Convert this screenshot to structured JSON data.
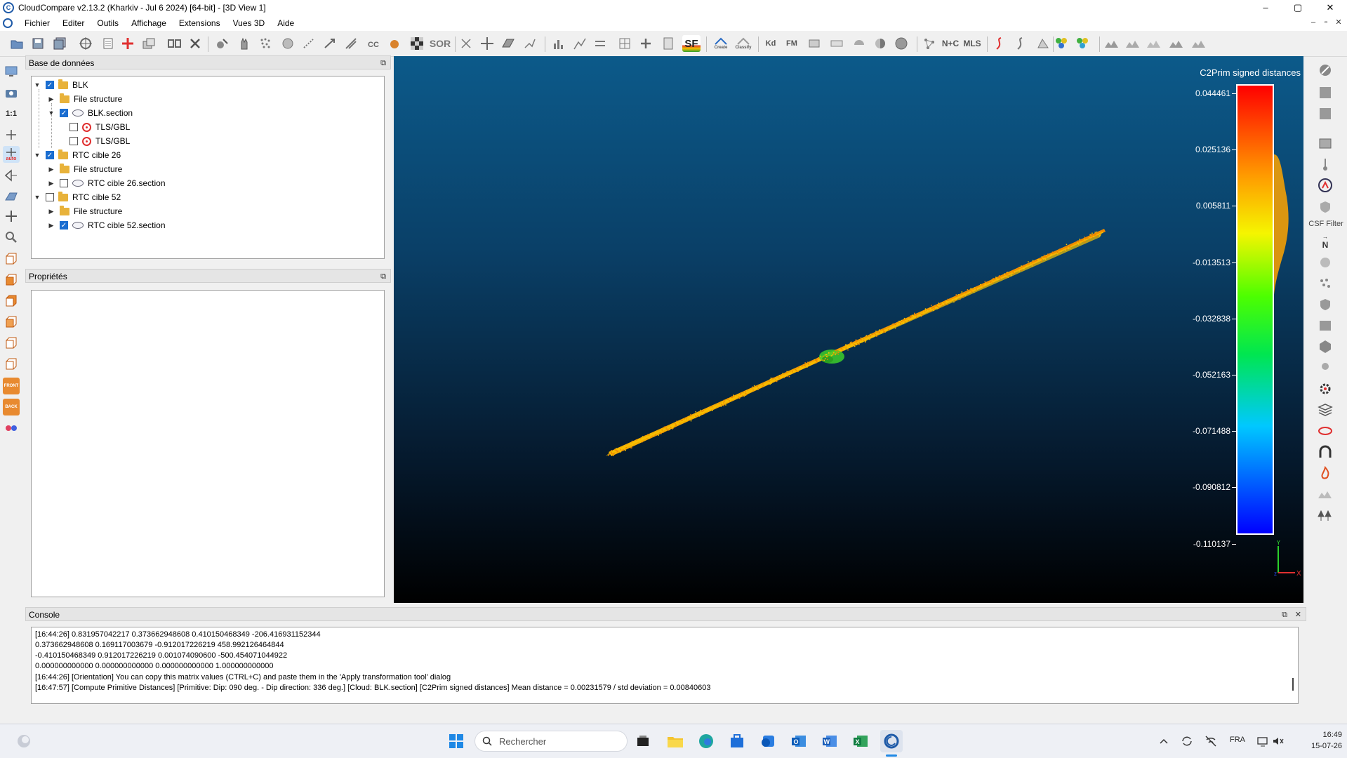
{
  "window": {
    "title": "CloudCompare v2.13.2 (Kharkiv - Jul  6 2024) [64-bit] - [3D View 1]",
    "minimize": "–",
    "maximize": "▢",
    "close": "✕"
  },
  "menu": {
    "items": [
      "Fichier",
      "Editer",
      "Outils",
      "Affichage",
      "Extensions",
      "Vues 3D",
      "Aide"
    ]
  },
  "toolbar": {
    "sor_label": "SOR",
    "sf_label": "SF",
    "kd_label": "Kd",
    "fm_label": "FM",
    "nc_label": "N+C",
    "mls_label": "MLS",
    "cloth_create": "Create",
    "cloth_classify": "Classify"
  },
  "left_toolbar": {
    "scale_label": "1:1",
    "auto_label": "auto",
    "front_label": "FRONT",
    "back_label": "BACK"
  },
  "db_panel": {
    "title": "Base de données",
    "tree": [
      {
        "label": "BLK",
        "checked": true,
        "expanded": true,
        "icon": "folder-icon"
      },
      {
        "label": "File structure",
        "icon": "folder-icon"
      },
      {
        "label": "BLK.section",
        "checked": true,
        "expanded": true,
        "icon": "cloud-icon"
      },
      {
        "label": "TLS/GBL",
        "checked": false,
        "icon": "target-icon"
      },
      {
        "label": "TLS/GBL",
        "checked": false,
        "icon": "target-icon"
      },
      {
        "label": "RTC cible 26",
        "checked": true,
        "expanded": true,
        "icon": "folder-icon"
      },
      {
        "label": "File structure",
        "icon": "folder-icon"
      },
      {
        "label": "RTC cible 26.section",
        "checked": false,
        "icon": "cloud-icon"
      },
      {
        "label": "RTC cible 52",
        "checked": false,
        "expanded": true,
        "icon": "folder-icon"
      },
      {
        "label": "File structure",
        "icon": "folder-icon"
      },
      {
        "label": "RTC cible 52.section",
        "checked": true,
        "icon": "cloud-icon"
      }
    ]
  },
  "props_panel": {
    "title": "Propriétés"
  },
  "view3d": {
    "sf_title": "C2Prim signed distances",
    "scale_labels": [
      "0.044461",
      "0.025136",
      "0.005811",
      "-0.013513",
      "-0.032838",
      "-0.052163",
      "-0.071488",
      "-0.090812",
      "-0.110137"
    ],
    "axis_y": "Y",
    "axis_x": "X",
    "colors": {
      "bg_top": "#0c5a8a",
      "bg_bottom": "#000000",
      "cloud": "#f5a000",
      "cloud_green": "#3ccf2a"
    }
  },
  "right_toolbar": {
    "csf_label": "CSF Filter",
    "n_label": "N"
  },
  "console": {
    "title": "Console",
    "lines": [
      "[16:44:26] 0.831957042217 0.373662948608 0.410150468349 -206.416931152344",
      "0.373662948608 0.169117003679 -0.912017226219 458.992126464844",
      "-0.410150468349 0.912017226219 0.001074090600 -500.454071044922",
      "0.000000000000 0.000000000000 0.000000000000 1.000000000000",
      "[16:44:26] [Orientation] You can copy this matrix values (CTRL+C) and paste them in the 'Apply transformation tool' dialog",
      "[16:47:57] [Compute Primitive Distances] [Primitive: Dip: 090 deg. - Dip direction: 336 deg.] [Cloud: BLK.section] [C2Prim signed distances] Mean distance = 0.00231579 / std deviation = 0.00840603"
    ]
  },
  "taskbar": {
    "search_placeholder": "Rechercher",
    "lang": "FRA",
    "time": "16:49",
    "date": "15-07-26"
  }
}
